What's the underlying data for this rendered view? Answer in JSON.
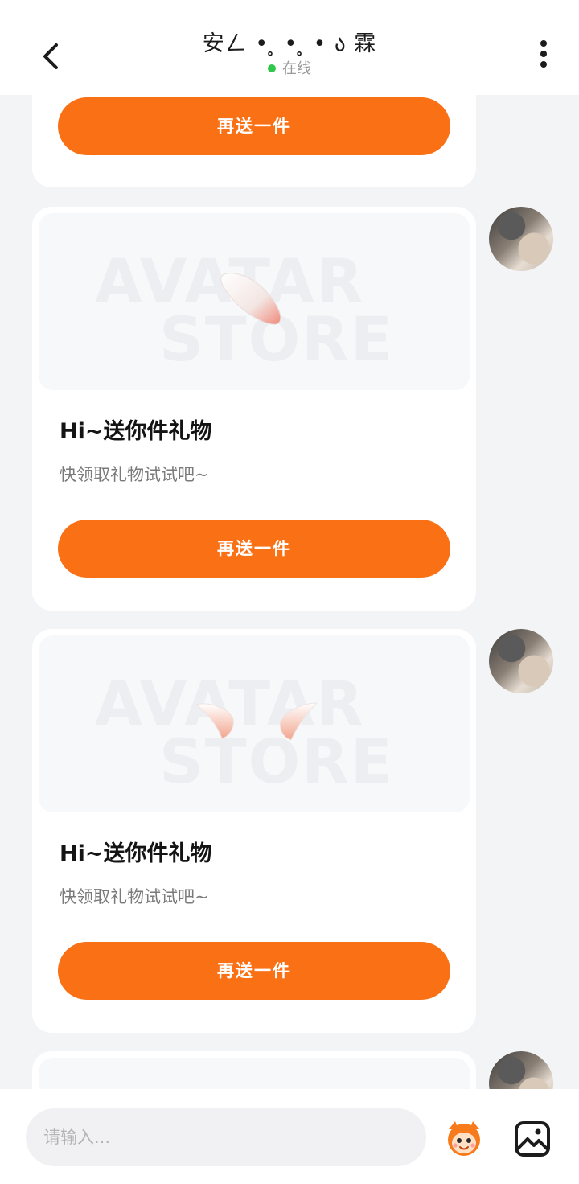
{
  "header": {
    "title": "安ㄥ • ̥ • ̥ • ა 霖",
    "status": "在线",
    "status_color": "#2fc84a"
  },
  "icons": {
    "back": "chevron-left-icon",
    "more": "more-vertical-icon",
    "mascot": "mascot-face-icon",
    "image": "image-icon"
  },
  "accent_color": "#f97015",
  "messages": [
    {
      "type": "gift-card-partial",
      "button_label": "再送一件"
    },
    {
      "type": "gift-card",
      "watermark_1": "AVATAR",
      "watermark_2": "STORE",
      "title": "Hi~送你件礼物",
      "subtitle": "快领取礼物试试吧~",
      "button_label": "再送一件",
      "gift": "feather"
    },
    {
      "type": "gift-card",
      "watermark_1": "AVATAR",
      "watermark_2": "STORE",
      "title": "Hi~送你件礼物",
      "subtitle": "快领取礼物试试吧~",
      "button_label": "再送一件",
      "gift": "ears"
    }
  ],
  "footer": {
    "input_placeholder": "请输入..."
  }
}
